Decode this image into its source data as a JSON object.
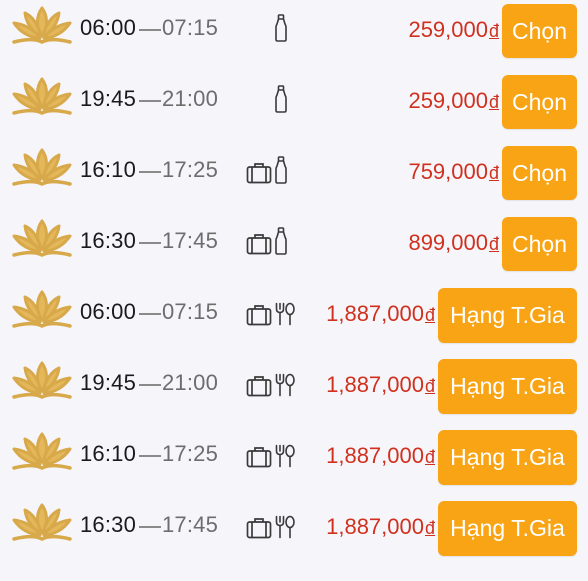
{
  "colors": {
    "accent_button": "#f8a414",
    "price": "#d0311f",
    "logo_gold": "#d8a94a"
  },
  "flights": [
    {
      "depart": "06:00",
      "arrive": "07:15",
      "amenities": [
        "bottle-icon"
      ],
      "price": "259,000",
      "currency": "đ",
      "button": "Chọn"
    },
    {
      "depart": "19:45",
      "arrive": "21:00",
      "amenities": [
        "bottle-icon"
      ],
      "price": "259,000",
      "currency": "đ",
      "button": "Chọn"
    },
    {
      "depart": "16:10",
      "arrive": "17:25",
      "amenities": [
        "luggage-icon",
        "bottle-icon"
      ],
      "price": "759,000",
      "currency": "đ",
      "button": "Chọn"
    },
    {
      "depart": "16:30",
      "arrive": "17:45",
      "amenities": [
        "luggage-icon",
        "bottle-icon"
      ],
      "price": "899,000",
      "currency": "đ",
      "button": "Chọn"
    },
    {
      "depart": "06:00",
      "arrive": "07:15",
      "amenities": [
        "luggage-icon",
        "meal-icon"
      ],
      "price": "1,887,000",
      "currency": "đ",
      "button": "Hạng T.Gia"
    },
    {
      "depart": "19:45",
      "arrive": "21:00",
      "amenities": [
        "luggage-icon",
        "meal-icon"
      ],
      "price": "1,887,000",
      "currency": "đ",
      "button": "Hạng T.Gia"
    },
    {
      "depart": "16:10",
      "arrive": "17:25",
      "amenities": [
        "luggage-icon",
        "meal-icon"
      ],
      "price": "1,887,000",
      "currency": "đ",
      "button": "Hạng T.Gia"
    },
    {
      "depart": "16:30",
      "arrive": "17:45",
      "amenities": [
        "luggage-icon",
        "meal-icon"
      ],
      "price": "1,887,000",
      "currency": "đ",
      "button": "Hạng T.Gia"
    }
  ]
}
